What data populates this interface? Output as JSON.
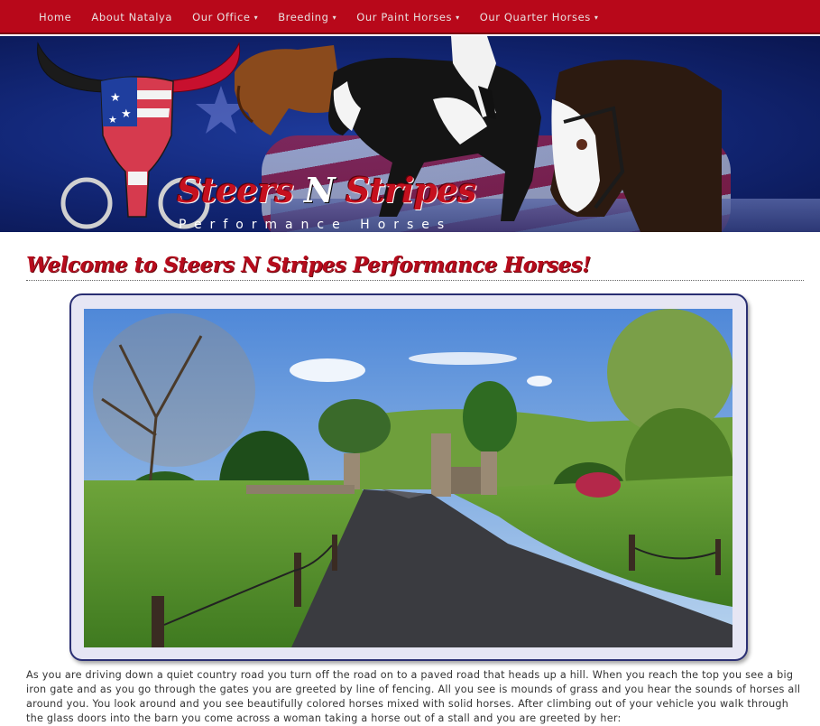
{
  "nav": {
    "items": [
      {
        "label": "Home",
        "dropdown": false
      },
      {
        "label": "About Natalya",
        "dropdown": false
      },
      {
        "label": "Our Office",
        "dropdown": true
      },
      {
        "label": "Breeding",
        "dropdown": true
      },
      {
        "label": "Our Paint Horses",
        "dropdown": true
      },
      {
        "label": "Our Quarter Horses",
        "dropdown": true
      }
    ],
    "caret": "▾"
  },
  "banner": {
    "title_part1": "Steers ",
    "title_part2": "N",
    "title_part3": " Stripes",
    "subtitle": "Performance Horses"
  },
  "page": {
    "heading": "Welcome to Steers N Stripes Performance Horses!",
    "intro": "As you are driving down a quiet country road you turn off the road on to a paved road that heads up a hill. When you reach the top you see a big iron gate and as you go through the gates you are greeted by line of fencing. All you see is mounds of grass and you hear the sounds of horses all around you. You look around and you see beautifully colored horses mixed with solid horses. After climbing out of your vehicle you walk through the glass doors into the barn you come across a woman taking a horse out of a stall and you are greeted by her:"
  },
  "colors": {
    "nav_bg": "#b8081a",
    "banner_bg": "#13287a",
    "heading": "#b70b1c",
    "frame_border": "#2a2f73"
  }
}
